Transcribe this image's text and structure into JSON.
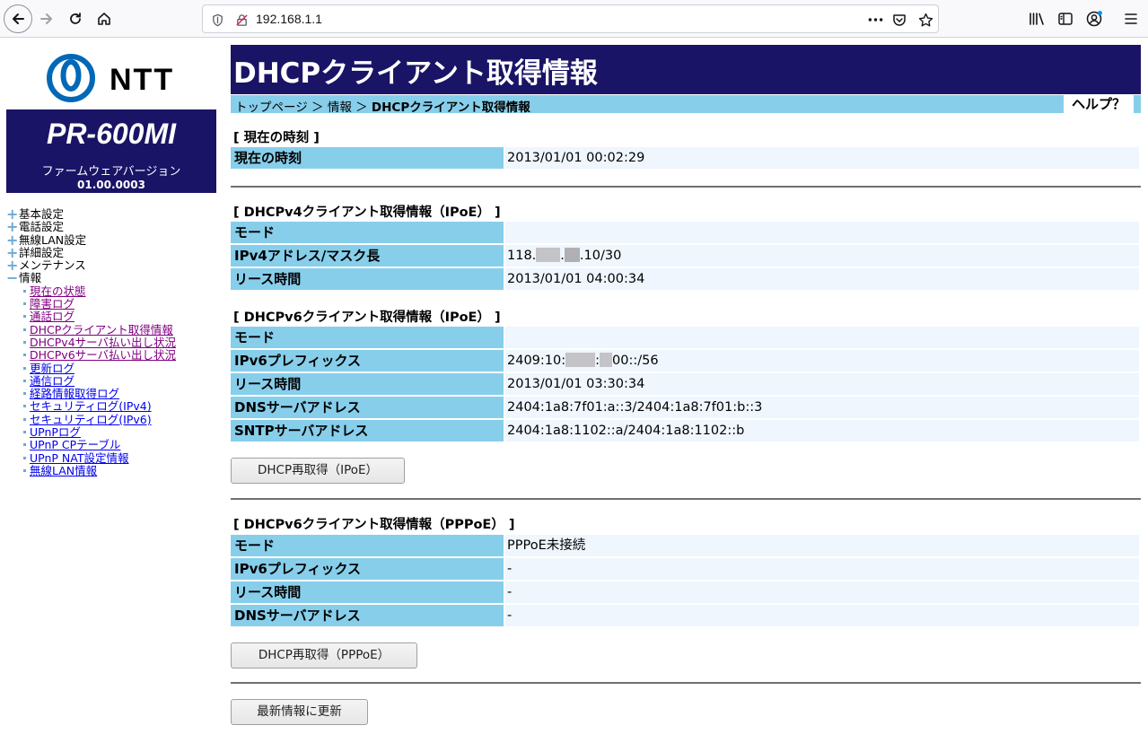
{
  "browser": {
    "url": "192.168.1.1"
  },
  "sidebar": {
    "logo_text": "NTT",
    "model": "PR-600MI",
    "firmware_label": "ファームウェアバージョン",
    "firmware_version": "01.00.0003",
    "menu": [
      {
        "label": "基本設定",
        "state": "collapsed"
      },
      {
        "label": "電話設定",
        "state": "collapsed"
      },
      {
        "label": "無線LAN設定",
        "state": "collapsed"
      },
      {
        "label": "詳細設定",
        "state": "collapsed"
      },
      {
        "label": "メンテナンス",
        "state": "collapsed"
      },
      {
        "label": "情報",
        "state": "expanded"
      }
    ],
    "sub_items": [
      {
        "label": "現在の状態",
        "visited": true
      },
      {
        "label": "障害ログ",
        "visited": true
      },
      {
        "label": "通話ログ",
        "visited": true
      },
      {
        "label": "DHCPクライアント取得情報",
        "visited": true
      },
      {
        "label": "DHCPv4サーバ払い出し状況",
        "visited": true
      },
      {
        "label": "DHCPv6サーバ払い出し状況",
        "visited": true
      },
      {
        "label": "更新ログ",
        "visited": false
      },
      {
        "label": "通信ログ",
        "visited": false
      },
      {
        "label": "経路情報取得ログ",
        "visited": false
      },
      {
        "label": "セキュリティログ(IPv4)",
        "visited": false
      },
      {
        "label": "セキュリティログ(IPv6)",
        "visited": false
      },
      {
        "label": "UPnPログ",
        "visited": false
      },
      {
        "label": "UPnP CPテーブル",
        "visited": false
      },
      {
        "label": "UPnP NAT設定情報",
        "visited": false
      },
      {
        "label": "無線LAN情報",
        "visited": false
      }
    ]
  },
  "page": {
    "title": "DHCPクライアント取得情報",
    "breadcrumb": {
      "top": "トップページ",
      "sep1": "＞",
      "info": "情報",
      "sep2": "＞",
      "current": "DHCPクライアント取得情報"
    },
    "help": "ヘルプ？"
  },
  "time_section": {
    "title": "[ 現在の時刻 ]",
    "rows": [
      {
        "label": "現在の時刻",
        "value": "2013/01/01 00:02:29"
      }
    ]
  },
  "ipv4_section": {
    "title": "[ DHCPv4クライアント取得情報（IPoE） ]",
    "rows": [
      {
        "label": "モード",
        "value": ""
      },
      {
        "label": "IPv4アドレス/マスク長",
        "value_prefix": "118.",
        "value_mid": ".",
        "value_suffix": ".10/30"
      },
      {
        "label": "リース時間",
        "value": "2013/01/01 04:00:34"
      }
    ]
  },
  "ipv6_section": {
    "title": "[ DHCPv6クライアント取得情報（IPoE） ]",
    "rows": [
      {
        "label": "モード",
        "value": ""
      },
      {
        "label": "IPv6プレフィックス",
        "value_prefix": "2409:10:",
        "value_mid": ":",
        "value_suffix": "00::/56"
      },
      {
        "label": "リース時間",
        "value": "2013/01/01 03:30:34"
      },
      {
        "label": "DNSサーバアドレス",
        "value": "2404:1a8:7f01:a::3/2404:1a8:7f01:b::3"
      },
      {
        "label": "SNTPサーバアドレス",
        "value": "2404:1a8:1102::a/2404:1a8:1102::b"
      }
    ],
    "button": "DHCP再取得（IPoE）"
  },
  "pppoe_section": {
    "title": "[ DHCPv6クライアント取得情報（PPPoE） ]",
    "rows": [
      {
        "label": "モード",
        "value": "PPPoE未接続"
      },
      {
        "label": "IPv6プレフィックス",
        "value": "-"
      },
      {
        "label": "リース時間",
        "value": "-"
      },
      {
        "label": "DNSサーバアドレス",
        "value": "-"
      }
    ],
    "button": "DHCP再取得（PPPoE）"
  },
  "refresh_button": "最新情報に更新",
  "colors": {
    "header_navy": "#1a1466",
    "label_sky": "#87ceeb",
    "value_bg": "#eff6fd",
    "logo_blue": "#0068b7"
  }
}
